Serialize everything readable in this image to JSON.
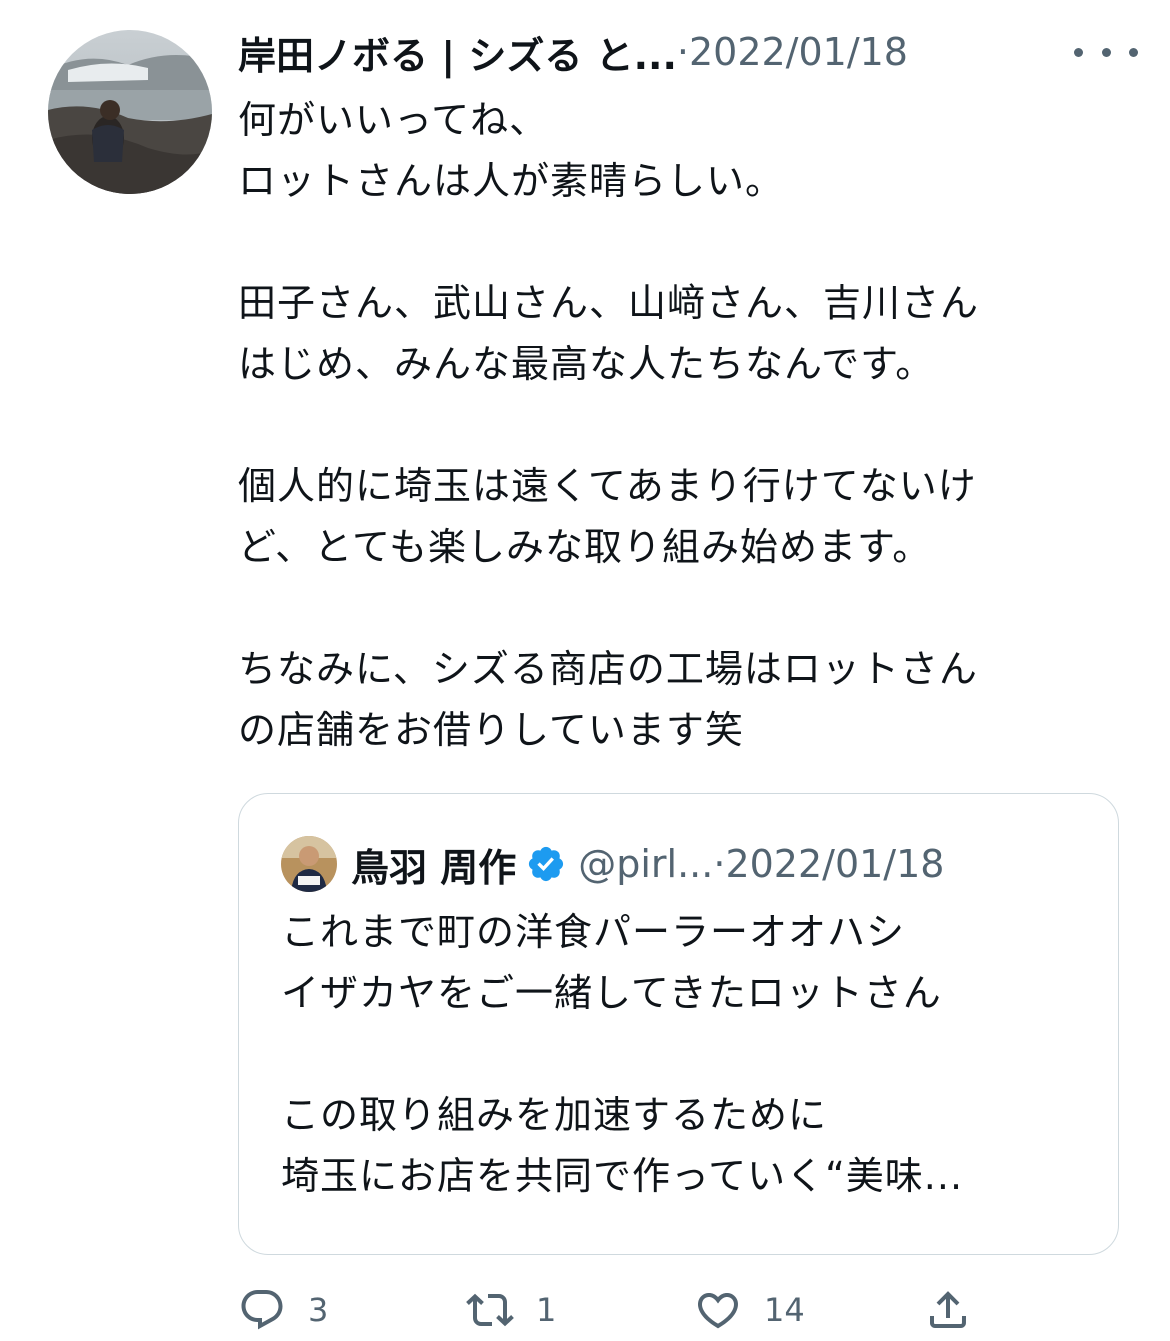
{
  "tweet": {
    "author_name": "岸田ノボる | シズる と...",
    "separator": " · ",
    "date": "2022/01/18",
    "text": "何がいいってね、\nロットさんは人が素晴らしい。\n\n田子さん、武山さん、山﨑さん、吉川さん\nはじめ、みんな最高な人たちなんです。\n\n個人的に埼玉は遠くてあまり行けてないけ\nど、とても楽しみな取り組み始めます。\n\nちなみに、シズる商店の工場はロットさん\nの店舗をお借りしています笑"
  },
  "quote": {
    "author_name": "鳥羽 周作",
    "handle": "@pirl...",
    "separator": " · ",
    "date": "2022/01/18",
    "text": "これまで町の洋食パーラーオオハシ\nイザカヤをご一緒してきたロットさん\n\nこの取り組みを加速するために\n埼玉にお店を共同で作っていく“美味..."
  },
  "actions": {
    "reply_count": "3",
    "retweet_count": "1",
    "like_count": "14"
  },
  "icons": {
    "more": "more-icon",
    "verified": "verified-badge-icon",
    "reply": "reply-icon",
    "retweet": "retweet-icon",
    "like": "heart-icon",
    "share": "share-icon"
  },
  "colors": {
    "text": "#0f1419",
    "secondary": "#536471",
    "verified": "#1d9bf0",
    "border": "#cfd9de"
  }
}
